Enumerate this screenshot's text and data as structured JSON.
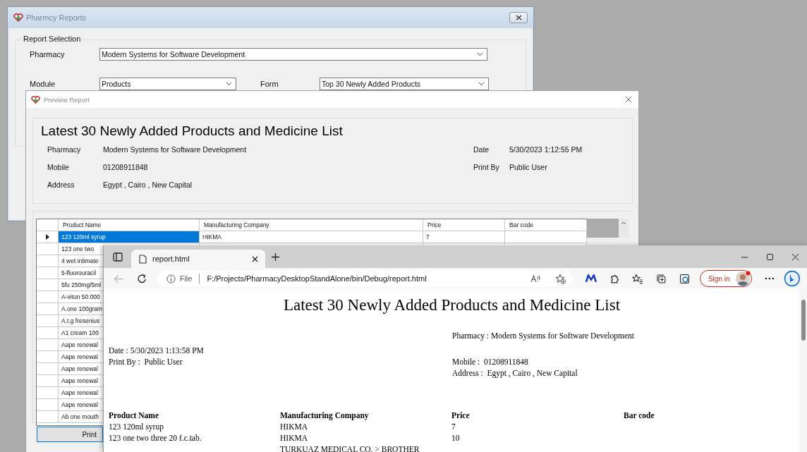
{
  "reports_window": {
    "title": "Pharmcy Reports",
    "group_title": "Report Selection",
    "pharmacy": {
      "label": "Pharmacy",
      "value": "Modern Systems for Software Development"
    },
    "module": {
      "label": "Module",
      "value": "Products"
    },
    "form": {
      "label": "Form",
      "value": "Top 30 Newly Added Products"
    }
  },
  "preview_window": {
    "title": "Preview Report",
    "report_title": "Latest 30 Newly Added Products and Medicine List",
    "info": [
      {
        "label": "Pharmacy",
        "value": "Modern Systems for Software Development",
        "side_label": "Date",
        "side_value": "5/30/2023 1:12:55 PM"
      },
      {
        "label": "Mobile",
        "value": "01208911848",
        "side_label": "Print By",
        "side_value": "Public User"
      },
      {
        "label": "Address",
        "value": "Egypt , Cairo , New Capital"
      }
    ],
    "grid": {
      "columns": [
        "Product Name",
        "Manufacturing Company",
        "Price",
        "Bar code"
      ],
      "rows": [
        {
          "selected": true,
          "cells": [
            "123 120ml syrup",
            "HIKMA",
            "7"
          ]
        },
        {
          "selected": false,
          "cells": [
            "123 one two"
          ]
        },
        {
          "selected": false,
          "cells": [
            "4 wet intimate"
          ]
        },
        {
          "selected": false,
          "cells": [
            "5-fluorouracil"
          ]
        },
        {
          "selected": false,
          "cells": [
            "5fu 250mg/5ml"
          ]
        },
        {
          "selected": false,
          "cells": [
            "A-viton 50.000"
          ]
        },
        {
          "selected": false,
          "cells": [
            "A.one 100gram"
          ]
        },
        {
          "selected": false,
          "cells": [
            "A.t.g fresenius"
          ]
        },
        {
          "selected": false,
          "cells": [
            "A1 cream 100"
          ]
        },
        {
          "selected": false,
          "cells": [
            "Aape renewal"
          ]
        },
        {
          "selected": false,
          "cells": [
            "Aape renewal"
          ]
        },
        {
          "selected": false,
          "cells": [
            "Aape renewal"
          ]
        },
        {
          "selected": false,
          "cells": [
            "Aape renewal"
          ]
        },
        {
          "selected": false,
          "cells": [
            "Aape renewal"
          ]
        },
        {
          "selected": false,
          "cells": [
            "Aape renewal"
          ]
        },
        {
          "selected": false,
          "cells": [
            "Ab one mouth"
          ]
        }
      ]
    },
    "print_button": "Print"
  },
  "browser": {
    "tab_title": "report.html",
    "address_scheme": "File",
    "url": "F:/Projects/PharmacyDesktopStandAlone/bin/Debug/report.html",
    "sign_in": "Sign in",
    "page": {
      "title": "Latest 30 Newly Added Products and Medicine List",
      "pharmacy": "Pharmacy : Modern Systems for Software Development",
      "date": "Date : 5/30/2023 1:13:58 PM",
      "print_by": "Print By :  Public User",
      "mobile": "Mobile :  01208911848",
      "address": "Address :  Egypt , Cairo , New Capital",
      "columns": [
        "Product Name",
        "Manufacturing Company",
        "Price",
        "Bar code"
      ],
      "rows": [
        [
          "123 120ml syrup",
          "HIKMA",
          "7"
        ],
        [
          "123 one two three 20 f.c.tab.",
          "HIKMA",
          "10"
        ],
        [
          "",
          "TURKUAZ MEDICAL CO. > BROTHER",
          ""
        ]
      ]
    }
  }
}
